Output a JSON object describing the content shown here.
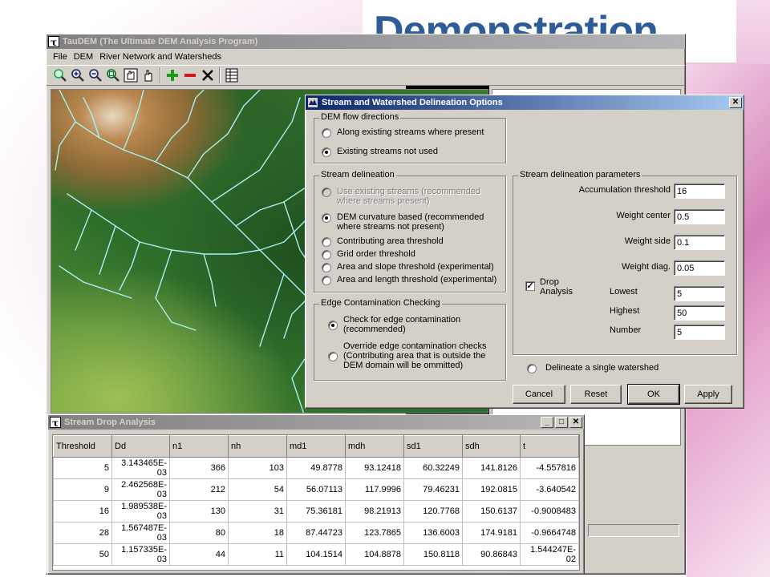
{
  "slide": {
    "title": "Demonstration"
  },
  "main_window": {
    "title": "TauDEM (The Ultimate DEM Analysis Program)",
    "menu": [
      "File",
      "DEM",
      "River Network and Watersheds"
    ]
  },
  "toolbar": {
    "icons": [
      "zoom-in-icon",
      "zoom-in-plus-icon",
      "zoom-out-icon",
      "zoom-extent-icon",
      "pan-icon",
      "select-hand-icon",
      "add-icon",
      "remove-icon",
      "delete-icon",
      "table-icon"
    ]
  },
  "dialog": {
    "title": "Stream and Watershed Delineation Options",
    "flow": {
      "label": "DEM flow directions",
      "options": [
        "Along existing streams where present",
        "Existing streams not used"
      ],
      "selected": 1
    },
    "stream": {
      "label": "Stream delineation",
      "options": [
        "Use existing streams (recommended where streams present)",
        "DEM curvature based (recommended where streams not present)",
        "Contributing area threshold",
        "Grid order threshold",
        "Area and slope threshold (experimental)",
        "Area and length threshold (experimental)"
      ],
      "selected": 1
    },
    "edge": {
      "label": "Edge Contamination Checking",
      "options": [
        "Check for edge contamination (recommended)",
        "Override edge contamination checks (Contributing area that is outside the DEM domain will be ommitted)"
      ],
      "selected": 0
    },
    "params": {
      "label": "Stream delineation parameters",
      "accumulation_threshold_label": "Accumulation threshold",
      "accumulation_threshold": "16",
      "weight_center_label": "Weight center",
      "weight_center": "0.5",
      "weight_side_label": "Weight side",
      "weight_side": "0.1",
      "weight_diag_label": "Weight diag.",
      "weight_diag": "0.05",
      "drop_analysis_label": "Drop Analysis",
      "drop_analysis_checked": true,
      "lowest_label": "Lowest",
      "lowest": "5",
      "highest_label": "Highest",
      "highest": "50",
      "number_label": "Number",
      "number": "5"
    },
    "single_watershed_label": "Delineate a single watershed",
    "buttons": {
      "cancel": "Cancel",
      "reset": "Reset",
      "ok": "OK",
      "apply": "Apply"
    }
  },
  "drop_window": {
    "title": "Stream Drop Analysis",
    "columns": [
      "Threshold",
      "Dd",
      "n1",
      "nh",
      "md1",
      "mdh",
      "sd1",
      "sdh",
      "t"
    ],
    "rows": [
      [
        "5",
        "3.143465E-03",
        "366",
        "103",
        "49.8778",
        "93.12418",
        "60.32249",
        "141.8126",
        "-4.557816"
      ],
      [
        "9",
        "2.462568E-03",
        "212",
        "54",
        "56.07113",
        "117.9996",
        "79.46231",
        "192.0815",
        "-3.640542"
      ],
      [
        "16",
        "1.989538E-03",
        "130",
        "31",
        "75.36181",
        "98.21913",
        "120.7768",
        "150.6137",
        "-0.9008483"
      ],
      [
        "28",
        "1.567487E-03",
        "80",
        "18",
        "87.44723",
        "123.7865",
        "136.6003",
        "174.9181",
        "-0.9664748"
      ],
      [
        "50",
        "1.157335E-03",
        "44",
        "11",
        "104.1514",
        "104.8878",
        "150.8118",
        "90.86843",
        "1.544247E-02"
      ]
    ]
  },
  "colors": {
    "title_blue": "#2e5c99",
    "active_title": "#0a246a",
    "inactive_title": "#808080",
    "terrain_low": "#2f6a2a",
    "terrain_high": "#b58a55",
    "stream": "#a8f0f0"
  }
}
